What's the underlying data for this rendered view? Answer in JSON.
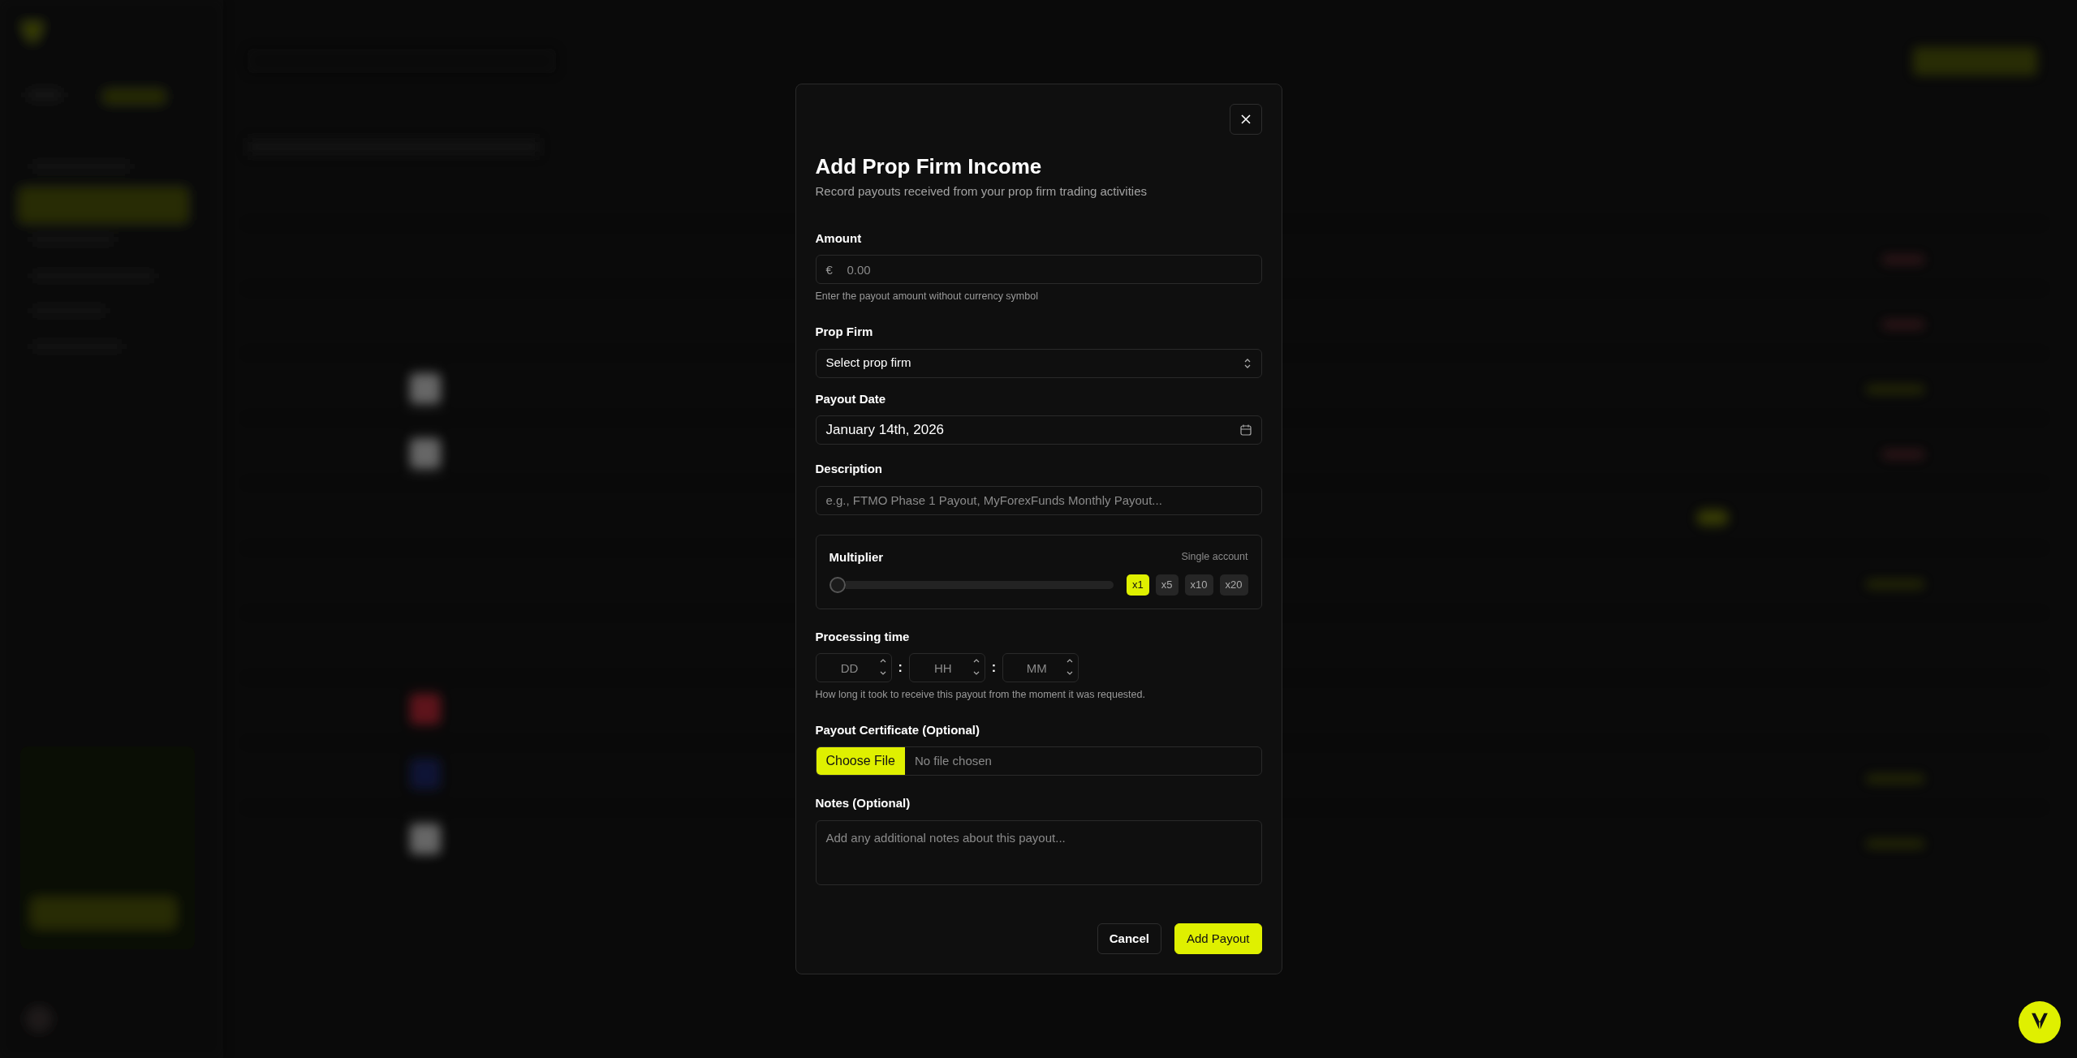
{
  "dialog": {
    "title": "Add Prop Firm Income",
    "subtitle": "Record payouts received from your prop firm trading activities",
    "amount": {
      "label": "Amount",
      "currency": "€",
      "placeholder": "0.00",
      "hint": "Enter the payout amount without currency symbol"
    },
    "prop_firm": {
      "label": "Prop Firm",
      "value": "Select prop firm"
    },
    "payout_date": {
      "label": "Payout Date",
      "value": "January 14th, 2026"
    },
    "description": {
      "label": "Description",
      "placeholder": "e.g., FTMO Phase 1 Payout, MyForexFunds Monthly Payout..."
    },
    "multiplier": {
      "label": "Multiplier",
      "caption": "Single account",
      "level": 0,
      "options": [
        {
          "label": "x1",
          "selected": true
        },
        {
          "label": "x5",
          "selected": false
        },
        {
          "label": "x10",
          "selected": false
        },
        {
          "label": "x20",
          "selected": false
        }
      ]
    },
    "processing_time": {
      "label": "Processing time",
      "fields": [
        {
          "placeholder": "DD"
        },
        {
          "placeholder": "HH"
        },
        {
          "placeholder": "MM"
        }
      ],
      "separators": [
        ":",
        ":"
      ],
      "hint": "How long it took to receive this payout from the moment it was requested."
    },
    "certificate": {
      "label": "Payout Certificate (Optional)",
      "button": "Choose File",
      "status": "No file chosen"
    },
    "notes": {
      "label": "Notes (Optional)",
      "placeholder": "Add any additional notes about this payout..."
    },
    "buttons": [
      {
        "label": "Cancel",
        "kind": "secondary"
      },
      {
        "label": "Add Payout",
        "kind": "primary"
      }
    ]
  }
}
